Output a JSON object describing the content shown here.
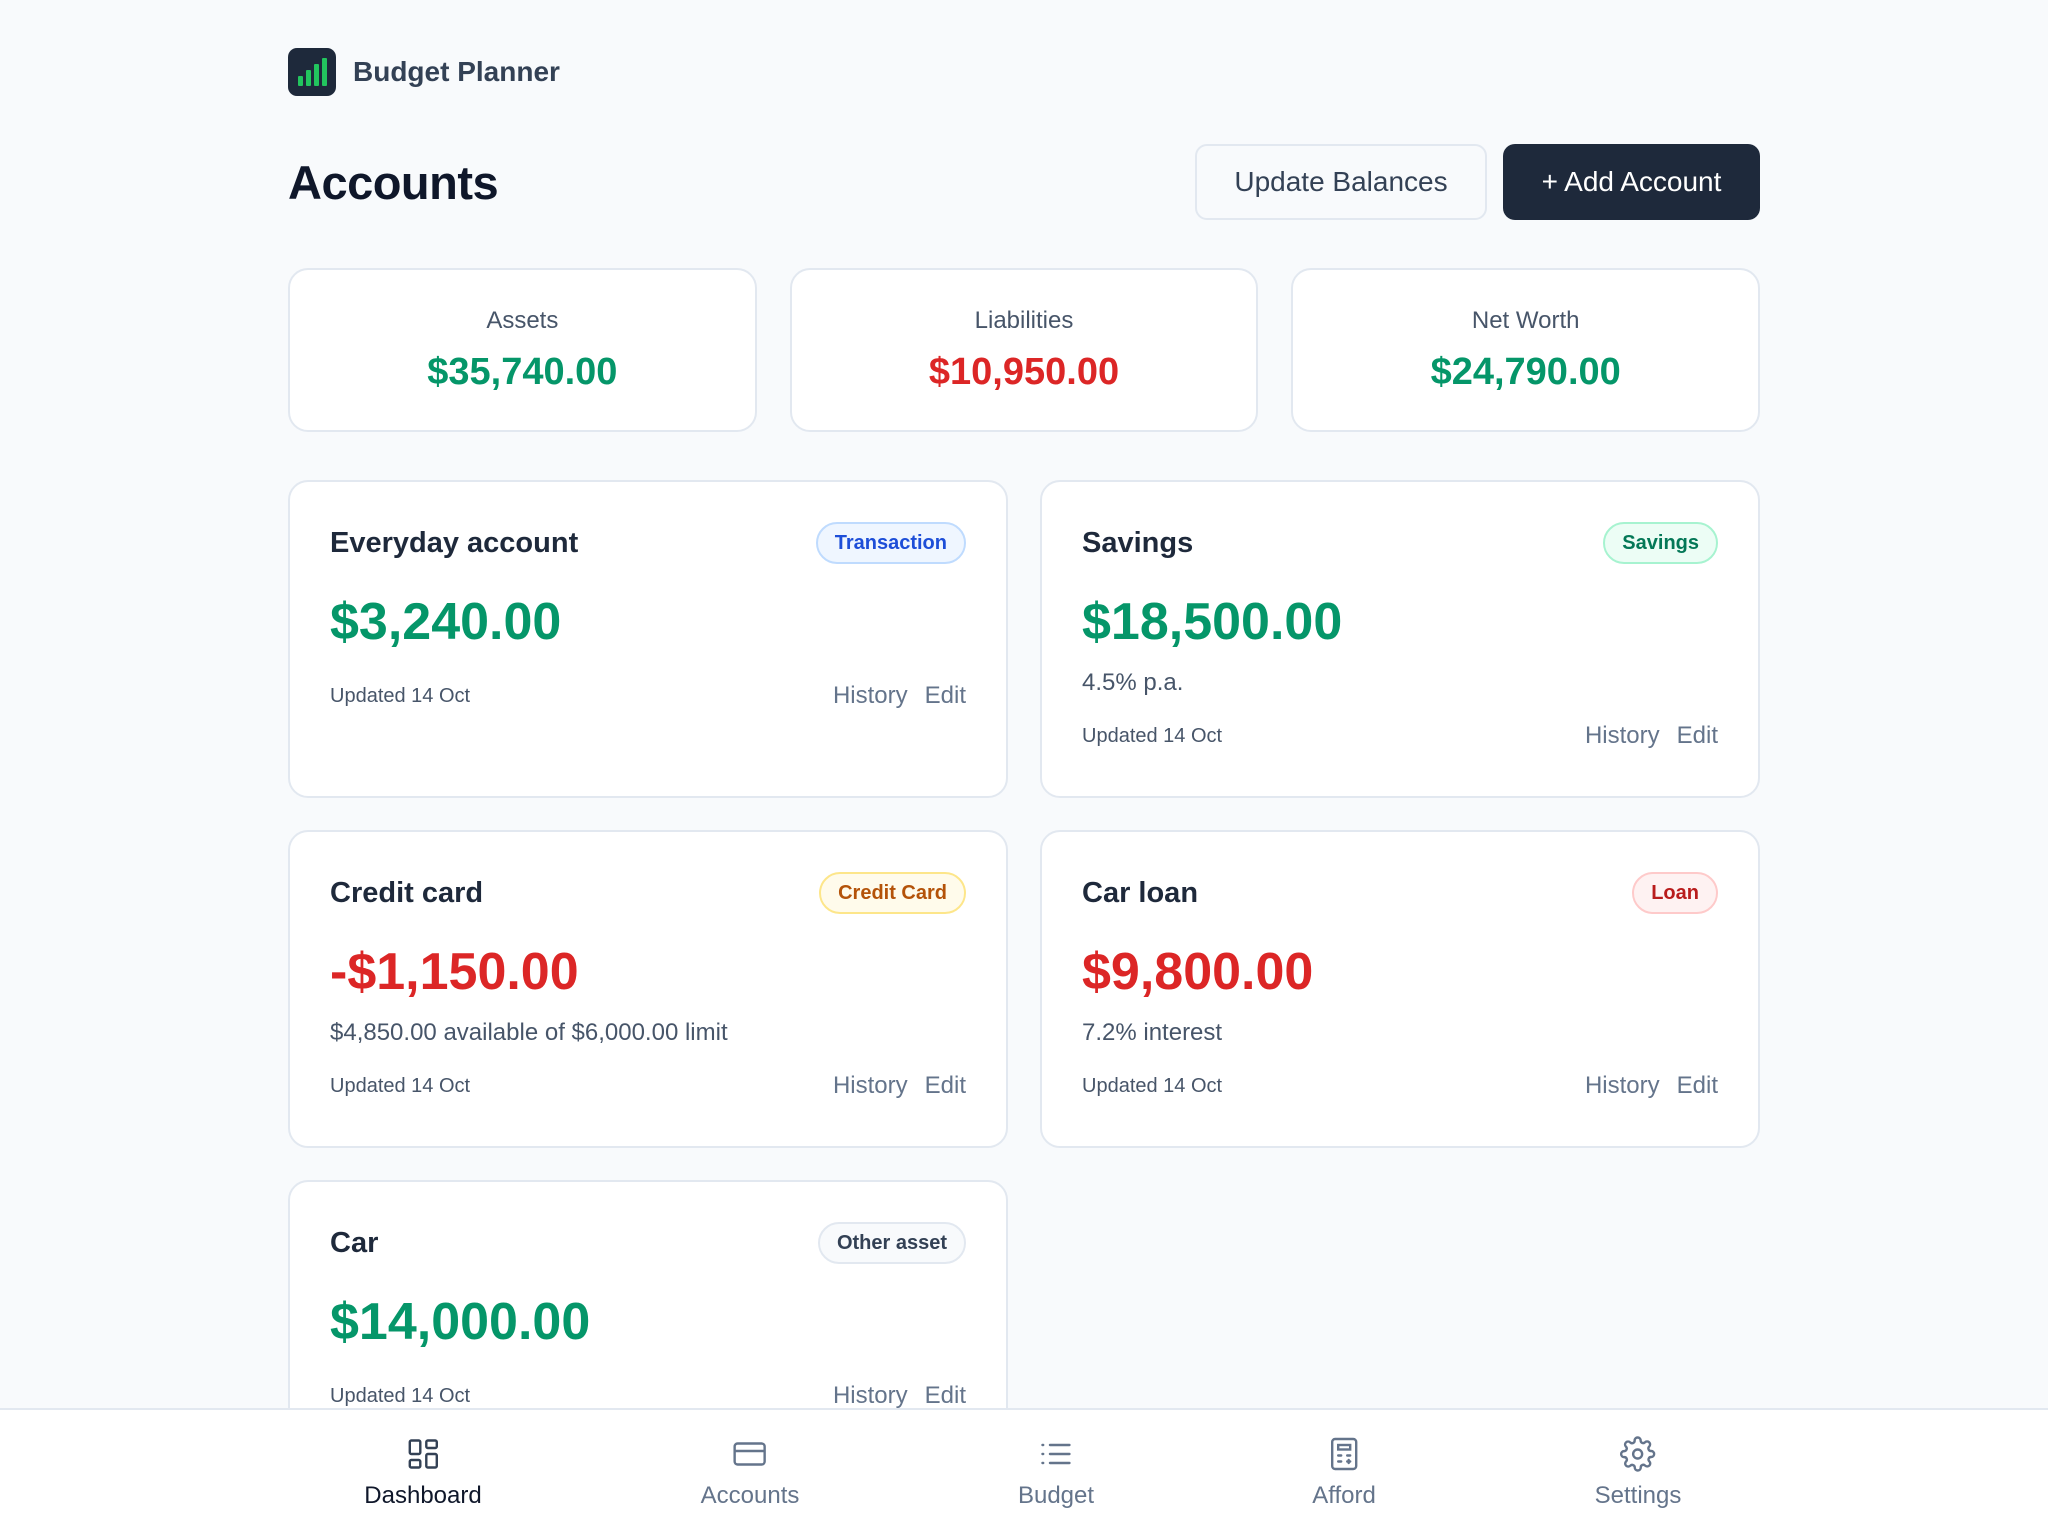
{
  "brand": {
    "name": "Budget Planner",
    "logo_icon": "bar-chart-icon"
  },
  "header": {
    "title": "Accounts",
    "update_label": "Update Balances",
    "add_label": "+ Add Account"
  },
  "summary": {
    "assets": {
      "label": "Assets",
      "value": "$35,740.00"
    },
    "liabilities": {
      "label": "Liabilities",
      "value": "$10,950.00"
    },
    "net_worth": {
      "label": "Net Worth",
      "value": "$24,790.00"
    }
  },
  "accounts": [
    {
      "name": "Everyday account",
      "type": "Transaction",
      "balance": "$3,240.00",
      "detail": "",
      "updated": "Updated 14 Oct",
      "history": "History",
      "edit": "Edit"
    },
    {
      "name": "Savings",
      "type": "Savings",
      "balance": "$18,500.00",
      "detail": "4.5% p.a.",
      "updated": "Updated 14 Oct",
      "history": "History",
      "edit": "Edit"
    },
    {
      "name": "Credit card",
      "type": "Credit Card",
      "balance": "-$1,150.00",
      "detail": "$4,850.00 available of $6,000.00 limit",
      "updated": "Updated 14 Oct",
      "history": "History",
      "edit": "Edit"
    },
    {
      "name": "Car loan",
      "type": "Loan",
      "balance": "$9,800.00",
      "detail": "7.2% interest",
      "updated": "Updated 14 Oct",
      "history": "History",
      "edit": "Edit"
    },
    {
      "name": "Car",
      "type": "Other asset",
      "balance": "$14,000.00",
      "detail": "",
      "updated": "Updated 14 Oct",
      "history": "History",
      "edit": "Edit"
    }
  ],
  "nav": [
    {
      "label": "Dashboard",
      "icon": "dashboard-icon",
      "active": true
    },
    {
      "label": "Accounts",
      "icon": "credit-card-icon",
      "active": false
    },
    {
      "label": "Budget",
      "icon": "list-icon",
      "active": false
    },
    {
      "label": "Afford",
      "icon": "calculator-icon",
      "active": false
    },
    {
      "label": "Settings",
      "icon": "gear-icon",
      "active": false
    }
  ],
  "colors": {
    "positive": "#059669",
    "negative": "#dc2626",
    "primary_button": "#1e293b",
    "background": "#f8fafc"
  }
}
